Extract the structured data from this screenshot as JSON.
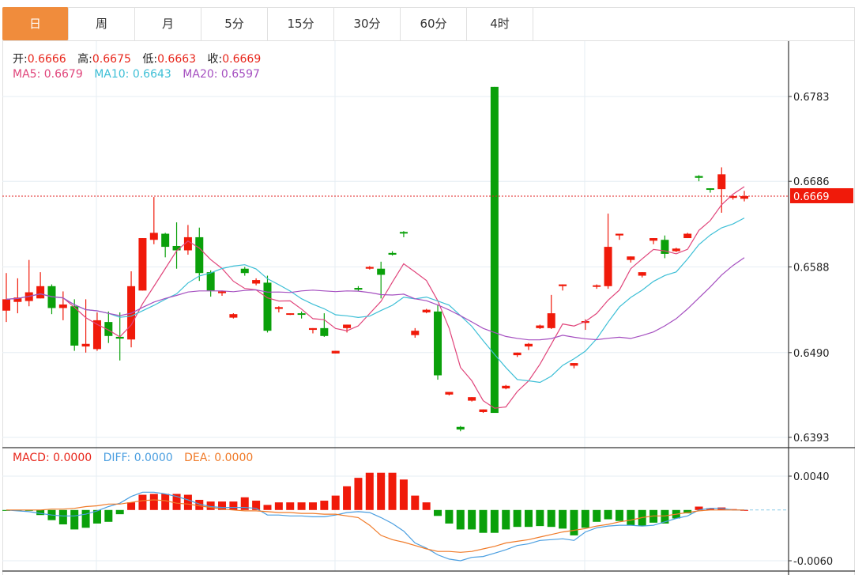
{
  "tabs": [
    {
      "label": "日",
      "active": true
    },
    {
      "label": "周"
    },
    {
      "label": "月"
    },
    {
      "label": "5分"
    },
    {
      "label": "15分"
    },
    {
      "label": "30分"
    },
    {
      "label": "60分"
    },
    {
      "label": "4时"
    }
  ],
  "ohlc_legend": {
    "open_label": "开:",
    "open": "0.6666",
    "high_label": "高:",
    "high": "0.6675",
    "low_label": "低:",
    "low": "0.6663",
    "close_label": "收:",
    "close": "0.6669"
  },
  "ma_legend": {
    "ma5_label": "MA5: ",
    "ma5": "0.6679",
    "ma10_label": "MA10: ",
    "ma10": "0.6643",
    "ma20_label": "MA20: ",
    "ma20": "0.6597"
  },
  "macd_legend": {
    "macd_label": "MACD: ",
    "macd": "0.0000",
    "diff_label": "DIFF: ",
    "diff": "0.0000",
    "dea_label": "DEA: ",
    "dea": "0.0000"
  },
  "price_axis": {
    "ticks": [
      "0.6783",
      "0.6686",
      "0.6588",
      "0.6490",
      "0.6393"
    ],
    "current": "0.6669"
  },
  "macd_axis": {
    "ticks": [
      "0.0040",
      "-0.0060"
    ]
  },
  "colors": {
    "up": "#f01a0a",
    "down": "#0aa00a",
    "ma5": "#e0457b",
    "ma10": "#3dbfd6",
    "ma20": "#a54fc0",
    "diff": "#4a9ee0",
    "dea": "#f07a28",
    "tab_active": "#f08c3c"
  },
  "chart_data": {
    "type": "candlestick",
    "price_range": [
      0.6393,
      0.6783
    ],
    "current_price": 0.6669,
    "candles_ohlc": [
      [
        0.6538,
        0.6581,
        0.6525,
        0.6551
      ],
      [
        0.6548,
        0.6575,
        0.6535,
        0.6553
      ],
      [
        0.6549,
        0.6596,
        0.6543,
        0.6559
      ],
      [
        0.6552,
        0.6582,
        0.6552,
        0.6566
      ],
      [
        0.6566,
        0.6568,
        0.6534,
        0.6541
      ],
      [
        0.6541,
        0.656,
        0.6527,
        0.6545
      ],
      [
        0.6543,
        0.6551,
        0.6492,
        0.6498
      ],
      [
        0.6497,
        0.6551,
        0.649,
        0.65
      ],
      [
        0.6494,
        0.6536,
        0.6492,
        0.6527
      ],
      [
        0.6525,
        0.6537,
        0.6501,
        0.6509
      ],
      [
        0.6508,
        0.6536,
        0.6481,
        0.6506
      ],
      [
        0.6505,
        0.6583,
        0.6496,
        0.6566
      ],
      [
        0.6561,
        0.6621,
        0.6561,
        0.6621
      ],
      [
        0.6619,
        0.6668,
        0.6614,
        0.6627
      ],
      [
        0.6626,
        0.6627,
        0.6599,
        0.6611
      ],
      [
        0.6612,
        0.6639,
        0.6586,
        0.6607
      ],
      [
        0.6607,
        0.6636,
        0.6602,
        0.6622
      ],
      [
        0.6622,
        0.6633,
        0.6572,
        0.6581
      ],
      [
        0.6582,
        0.6584,
        0.6554,
        0.6561
      ],
      [
        0.6558,
        0.6561,
        0.6555,
        0.656
      ],
      [
        0.653,
        0.6535,
        0.6529,
        0.6534
      ],
      [
        0.6586,
        0.6588,
        0.6578,
        0.6581
      ],
      [
        0.6569,
        0.6575,
        0.6567,
        0.6573
      ],
      [
        0.657,
        0.6578,
        0.6513,
        0.6515
      ],
      [
        0.654,
        0.6543,
        0.6536,
        0.6542
      ],
      [
        0.6534,
        0.6535,
        0.6533,
        0.6535
      ],
      [
        0.6535,
        0.6537,
        0.6529,
        0.6534
      ],
      [
        0.6516,
        0.6518,
        0.6512,
        0.6518
      ],
      [
        0.6518,
        0.6535,
        0.6508,
        0.6509
      ],
      [
        0.6489,
        0.6492,
        0.6489,
        0.6492
      ],
      [
        0.6518,
        0.6522,
        0.6513,
        0.6522
      ],
      [
        0.6564,
        0.6566,
        0.656,
        0.6562
      ],
      [
        0.6586,
        0.6589,
        0.6585,
        0.6588
      ],
      [
        0.6586,
        0.6594,
        0.6552,
        0.6579
      ],
      [
        0.6604,
        0.6606,
        0.6601,
        0.6602
      ],
      [
        0.6628,
        0.6629,
        0.6622,
        0.6627
      ],
      [
        0.651,
        0.6518,
        0.6507,
        0.6515
      ],
      [
        0.6536,
        0.654,
        0.6535,
        0.6539
      ],
      [
        0.6537,
        0.6545,
        0.6459,
        0.6464
      ],
      [
        0.6442,
        0.6445,
        0.6441,
        0.6445
      ],
      [
        0.6405,
        0.6406,
        0.64,
        0.6402
      ],
      [
        0.6435,
        0.6439,
        0.6434,
        0.6439
      ],
      [
        0.6422,
        0.6425,
        0.6421,
        0.6425
      ],
      [
        0.6794,
        0.6794,
        0.6421,
        0.6421
      ],
      [
        0.6449,
        0.6453,
        0.6448,
        0.6452
      ],
      [
        0.6487,
        0.649,
        0.6485,
        0.649
      ],
      [
        0.6497,
        0.6501,
        0.6493,
        0.65
      ],
      [
        0.6518,
        0.6522,
        0.6517,
        0.6521
      ],
      [
        0.6518,
        0.6556,
        0.6517,
        0.6535
      ],
      [
        0.6566,
        0.6568,
        0.6561,
        0.6568
      ],
      [
        0.6475,
        0.6478,
        0.6472,
        0.6478
      ],
      [
        0.6524,
        0.6528,
        0.6516,
        0.6526
      ],
      [
        0.6566,
        0.6568,
        0.6563,
        0.6567
      ],
      [
        0.6566,
        0.6649,
        0.6563,
        0.6611
      ],
      [
        0.6624,
        0.6626,
        0.6619,
        0.6626
      ],
      [
        0.6596,
        0.66,
        0.6593,
        0.66
      ],
      [
        0.6578,
        0.6582,
        0.6576,
        0.6582
      ],
      [
        0.6618,
        0.6621,
        0.6614,
        0.6621
      ],
      [
        0.6619,
        0.6624,
        0.6598,
        0.6603
      ],
      [
        0.6606,
        0.661,
        0.6605,
        0.6609
      ],
      [
        0.6621,
        0.6627,
        0.6621,
        0.6626
      ],
      [
        0.6692,
        0.6693,
        0.6686,
        0.669
      ],
      [
        0.6678,
        0.6678,
        0.6673,
        0.6677
      ],
      [
        0.6677,
        0.6702,
        0.665,
        0.6694
      ],
      [
        0.6667,
        0.667,
        0.6665,
        0.6669
      ],
      [
        0.6666,
        0.6675,
        0.6663,
        0.6669
      ]
    ],
    "macd_range": [
      -0.006,
      0.004
    ],
    "macd_hist": [
      -0.0001,
      -0.0001,
      -0.0001,
      -0.0006,
      -0.0012,
      -0.0017,
      -0.0023,
      -0.0021,
      -0.0016,
      -0.0014,
      -0.0005,
      0.0009,
      0.0018,
      0.0019,
      0.0019,
      0.0019,
      0.0018,
      0.0012,
      0.001,
      0.001,
      0.001,
      0.0015,
      0.0011,
      0.0006,
      0.0009,
      0.0009,
      0.0009,
      0.0009,
      0.0011,
      0.0017,
      0.0028,
      0.0038,
      0.0044,
      0.0044,
      0.0044,
      0.0036,
      0.0017,
      0.0009,
      -0.0007,
      -0.0016,
      -0.0023,
      -0.0023,
      -0.0027,
      -0.0027,
      -0.0023,
      -0.002,
      -0.002,
      -0.0019,
      -0.002,
      -0.0022,
      -0.003,
      -0.0021,
      -0.0014,
      -0.0011,
      -0.0013,
      -0.0018,
      -0.0019,
      -0.0015,
      -0.0016,
      -0.001,
      -0.0004,
      0.0004,
      0.0002,
      0.0003,
      0.0001,
      0.0
    ],
    "diff": [
      0,
      -0.0001,
      -0.0002,
      -0.0004,
      -0.0006,
      -0.0007,
      -0.0007,
      -0.0005,
      -0.0001,
      0.0004,
      0.0008,
      0.0016,
      0.0021,
      0.0021,
      0.0019,
      0.0016,
      0.0012,
      0.0007,
      0.0004,
      0.0003,
      0.0003,
      0.0003,
      0.0002,
      -0.0006,
      -0.0006,
      -0.0007,
      -0.0007,
      -0.0008,
      -0.0008,
      -0.0006,
      -0.0003,
      -0.0002,
      -0.0003,
      -0.0009,
      -0.0016,
      -0.0025,
      -0.0039,
      -0.0045,
      -0.0053,
      -0.0058,
      -0.006,
      -0.0056,
      -0.0055,
      -0.0051,
      -0.0047,
      -0.0042,
      -0.004,
      -0.0036,
      -0.0035,
      -0.0034,
      -0.0036,
      -0.0026,
      -0.0021,
      -0.0019,
      -0.0018,
      -0.0018,
      -0.0019,
      -0.0018,
      -0.0014,
      -0.001,
      -0.0007,
      0,
      0.0002,
      0.0002,
      0,
      0
    ],
    "dea": [
      0,
      0,
      0,
      0,
      0.0001,
      0.0001,
      0.0002,
      0.0004,
      0.0005,
      0.0007,
      0.0007,
      0.0009,
      0.0011,
      0.0012,
      0.0011,
      0.0008,
      0.0007,
      0.0005,
      0.0003,
      0.0001,
      0,
      -0.0001,
      -0.0001,
      -0.0002,
      -0.0003,
      -0.0003,
      -0.0004,
      -0.0004,
      -0.0005,
      -0.0005,
      -0.0007,
      -0.0009,
      -0.0018,
      -0.003,
      -0.0035,
      -0.0038,
      -0.0042,
      -0.0046,
      -0.0049,
      -0.0049,
      -0.005,
      -0.0049,
      -0.0046,
      -0.0043,
      -0.0039,
      -0.0037,
      -0.0035,
      -0.0032,
      -0.0029,
      -0.0026,
      -0.0024,
      -0.0022,
      -0.0019,
      -0.0017,
      -0.0014,
      -0.0012,
      -0.0009,
      -0.0007,
      -0.0007,
      -0.0005,
      -0.0003,
      -0.0001,
      0,
      0,
      0,
      0
    ]
  }
}
